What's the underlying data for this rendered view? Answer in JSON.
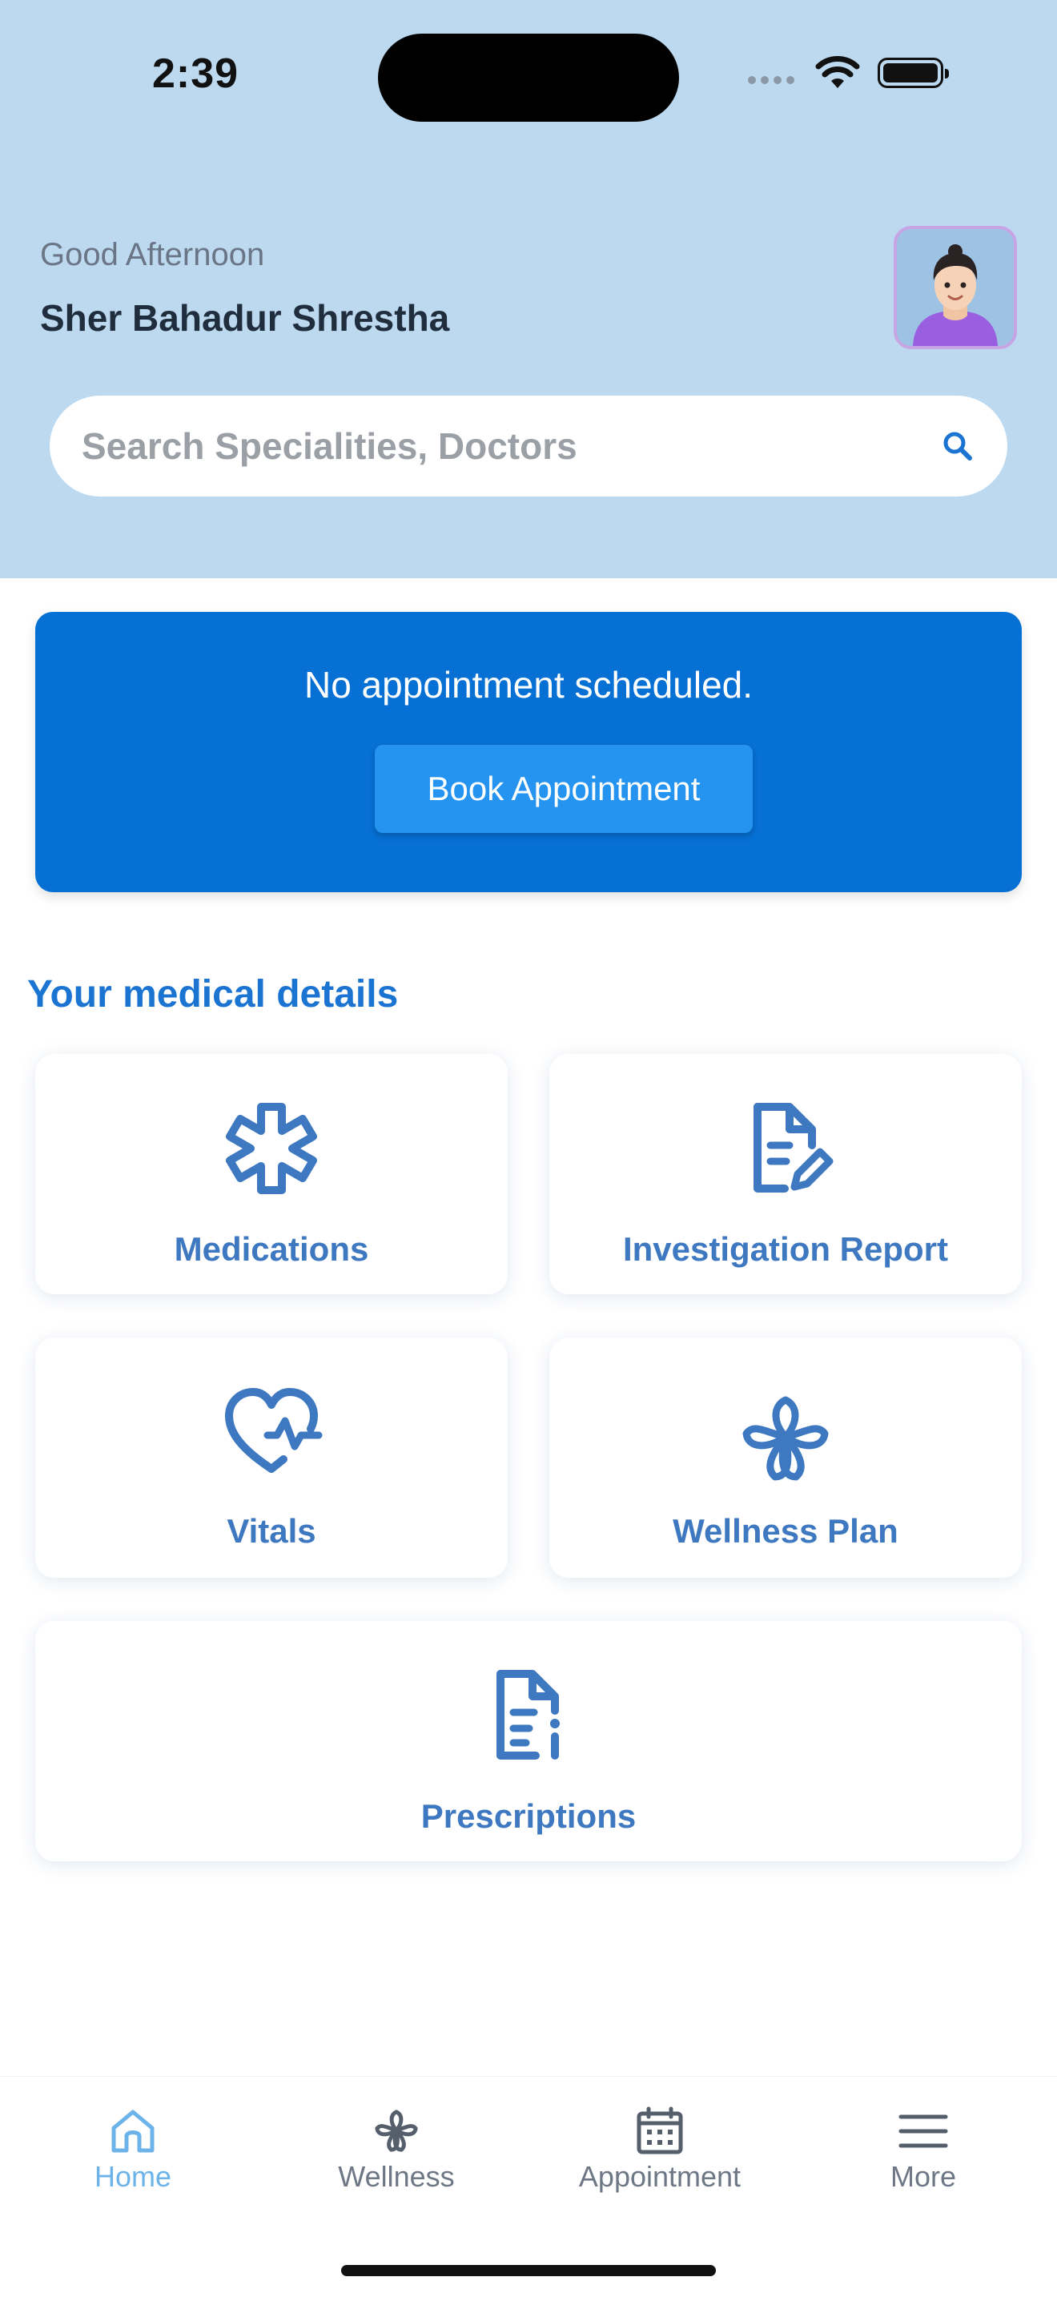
{
  "status_bar": {
    "time": "2:39"
  },
  "header": {
    "greeting": "Good Afternoon",
    "user_name": "Sher Bahadur Shrestha",
    "avatar_icon": "user-avatar"
  },
  "search": {
    "placeholder": "Search Specialities, Doctors",
    "icon": "search-icon"
  },
  "appointment": {
    "message": "No appointment scheduled.",
    "button_label": "Book Appointment"
  },
  "medical": {
    "title": "Your medical details",
    "tiles": [
      {
        "label": "Medications",
        "icon": "medical-star-icon"
      },
      {
        "label": "Investigation Report",
        "icon": "document-edit-icon"
      },
      {
        "label": "Vitals",
        "icon": "heart-pulse-icon"
      },
      {
        "label": "Wellness Plan",
        "icon": "flower-icon"
      },
      {
        "label": "Prescriptions",
        "icon": "document-info-icon"
      }
    ]
  },
  "bottom_nav": {
    "items": [
      {
        "label": "Home",
        "icon": "home-icon",
        "active": true
      },
      {
        "label": "Wellness",
        "icon": "flower-icon",
        "active": false
      },
      {
        "label": "Appointment",
        "icon": "calendar-icon",
        "active": false
      },
      {
        "label": "More",
        "icon": "menu-icon",
        "active": false
      }
    ]
  },
  "colors": {
    "header_bg": "#bcd9ef",
    "accent": "#0670d4",
    "button": "#2594f0",
    "tile_text": "#3d78c0",
    "active_nav": "#6cb3ea"
  }
}
